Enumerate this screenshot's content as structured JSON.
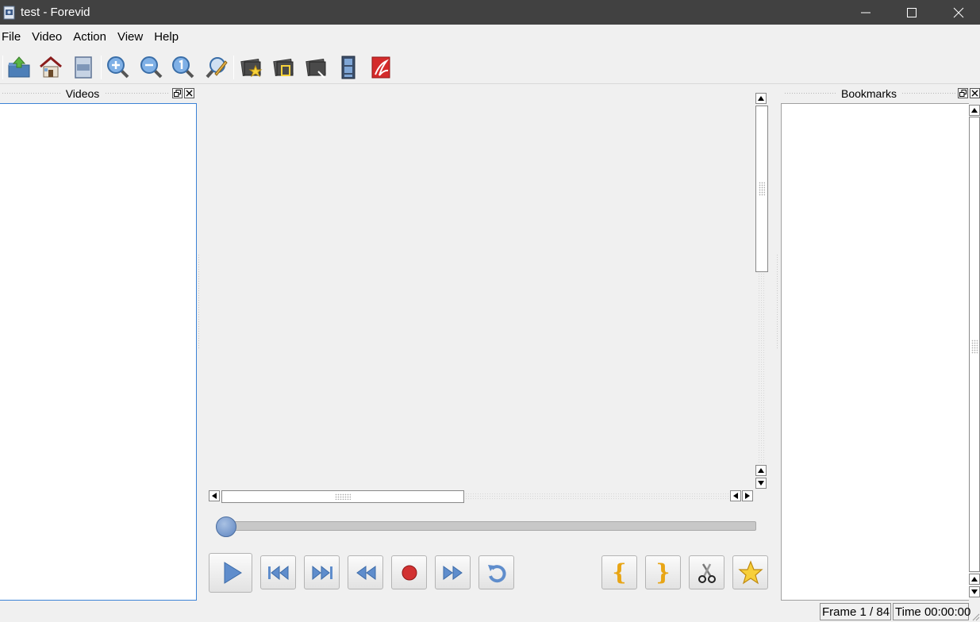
{
  "window": {
    "title": "test - Forevid",
    "icons": {
      "app": "film-page-icon",
      "minimize": "minimize-icon",
      "maximize": "maximize-icon",
      "close": "close-icon"
    }
  },
  "menu": [
    "File",
    "Video",
    "Action",
    "View",
    "Help"
  ],
  "toolbar": {
    "icons": [
      "open-folder-icon",
      "home-icon",
      "frame-icon",
      "zoom-in-icon",
      "zoom-out-icon",
      "zoom-reset-icon",
      "zoom-custom-icon",
      "bookmark-star-icon",
      "bookmark-clip-icon",
      "bookmark-export-icon",
      "film-strip-icon",
      "pdf-export-icon"
    ]
  },
  "videos_panel": {
    "title": "Videos",
    "items": []
  },
  "bookmarks_panel": {
    "title": "Bookmarks",
    "items": []
  },
  "player": {
    "position_fraction": 0.0,
    "buttons": [
      "play-icon",
      "skip-start-icon",
      "skip-end-icon",
      "rewind-icon",
      "record-icon",
      "fast-forward-icon",
      "loop-icon"
    ],
    "clip_buttons": [
      {
        "icon": "clip-start-icon",
        "glyph": "{"
      },
      {
        "icon": "clip-end-icon",
        "glyph": "}"
      },
      {
        "icon": "scissors-icon",
        "glyph": ""
      },
      {
        "icon": "star-icon",
        "glyph": ""
      }
    ]
  },
  "status": {
    "frame": "Frame 1 / 84",
    "time": "Time 00:00:00"
  },
  "colors": {
    "titlebar": "#414141",
    "accent": "#4a7fc8",
    "panel_border": "#3c83d6"
  }
}
